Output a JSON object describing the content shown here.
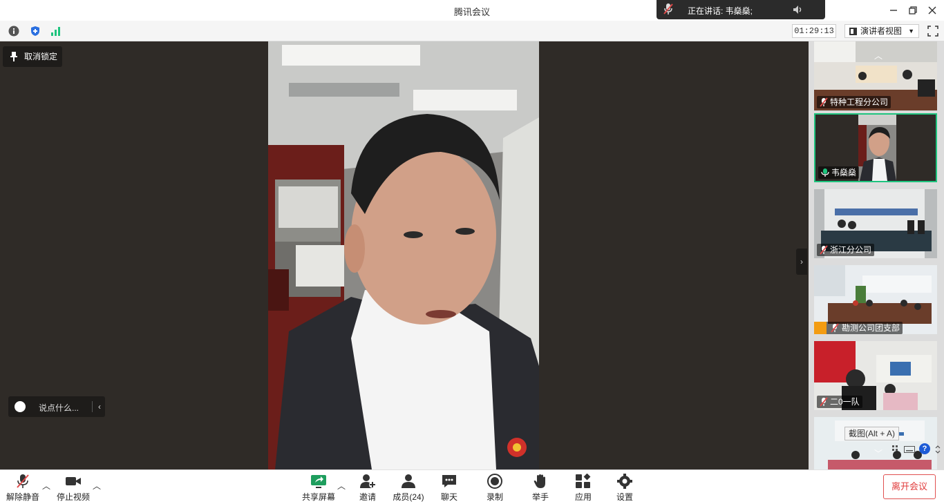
{
  "window": {
    "title": "腾讯会议",
    "speaking_label": "正在讲话: 韦燊燊;"
  },
  "infobar": {
    "timer": "01:29:13",
    "view_mode": "演讲者视图"
  },
  "stage": {
    "unlock_label": "取消锁定",
    "chat_placeholder": "说点什么..."
  },
  "participants": [
    {
      "name": "特种工程分公司",
      "mic": "muted",
      "active": false
    },
    {
      "name": "韦燊燊",
      "mic": "speaking",
      "active": true
    },
    {
      "name": "浙江分公司",
      "mic": "muted",
      "active": false
    },
    {
      "name": "勘测公司团支部",
      "mic": "muted",
      "active": false,
      "avatar": true
    },
    {
      "name": "二0一队",
      "mic": "muted",
      "active": false
    },
    {
      "name": "",
      "mic": "none",
      "active": false
    }
  ],
  "tooltip": "截图(Alt + A)",
  "toolbar": {
    "unmute": "解除静音",
    "stop_video": "停止视频",
    "share_screen": "共享屏幕",
    "invite": "邀请",
    "members": "成员(24)",
    "chat": "聊天",
    "record": "录制",
    "raise_hand": "举手",
    "apps": "应用",
    "settings": "设置",
    "leave": "离开会议"
  },
  "colors": {
    "accent_green": "#1ec47e",
    "leave_red": "#e03b3b",
    "stage_bg": "#2f2b27"
  }
}
